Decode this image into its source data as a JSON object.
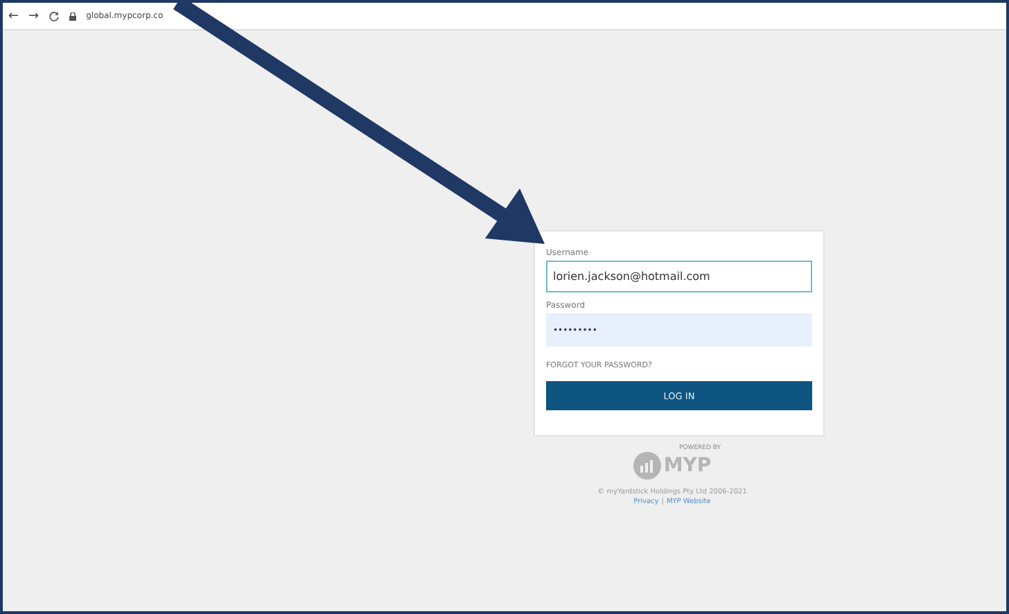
{
  "browser": {
    "back": "←",
    "forward": "→",
    "url": "global.mypcorp.co"
  },
  "login": {
    "username_label": "Username",
    "username_value": "lorien.jackson@hotmail.com",
    "password_label": "Password",
    "password_value": "•••••••••",
    "forgot_link": "FORGOT YOUR PASSWORD?",
    "login_button": "LOG IN"
  },
  "footer": {
    "powered_by": "POWERED BY",
    "logo_text": "MYP",
    "copyright": "© myYardstick Holdings Pty Ltd 2006-2021",
    "links": [
      "Privacy",
      "MYP Website"
    ],
    "separator": "|"
  }
}
